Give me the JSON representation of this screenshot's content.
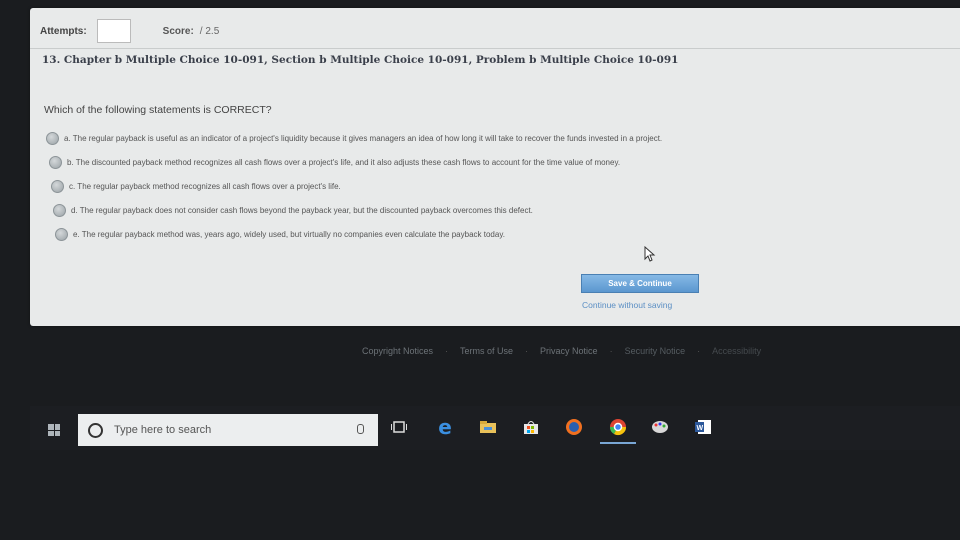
{
  "header": {
    "attempts_label": "Attempts:",
    "score_label": "Score:",
    "score_value": "/ 2.5"
  },
  "problem_title": "13. Chapter b Multiple Choice 10-091, Section b Multiple Choice 10-091, Problem b Multiple Choice 10-091",
  "question": "Which of the following statements is CORRECT?",
  "options": [
    {
      "label": "a. The regular payback is useful as an indicator of a project's liquidity because it gives managers an idea of how long it will take to recover the funds invested in a project."
    },
    {
      "label": "b. The discounted payback method recognizes all cash flows over a project's life, and it also adjusts these cash flows to account for the time value of money."
    },
    {
      "label": "c. The regular payback method recognizes all cash flows over a project's life."
    },
    {
      "label": "d. The regular payback does not consider cash flows beyond the payback year, but the discounted payback overcomes this defect."
    },
    {
      "label": "e. The regular payback method was, years ago, widely used, but virtually no companies even calculate the payback today."
    }
  ],
  "actions": {
    "save_label": "Save & Continue",
    "continue_label": "Continue without saving"
  },
  "footer": {
    "links": [
      "Copyright Notices",
      "Terms of Use",
      "Privacy Notice",
      "Security Notice",
      "Accessibility"
    ]
  },
  "taskbar": {
    "search_placeholder": "Type here to search",
    "icons": [
      "windows-start-icon",
      "microphone-icon",
      "task-view-icon",
      "edge-icon",
      "file-explorer-icon",
      "store-icon",
      "firefox-icon",
      "chrome-icon",
      "paint-icon",
      "word-icon"
    ]
  },
  "colors": {
    "button": "#5b97cf",
    "link": "#5b8fc4",
    "panel": "#e8eaea"
  }
}
